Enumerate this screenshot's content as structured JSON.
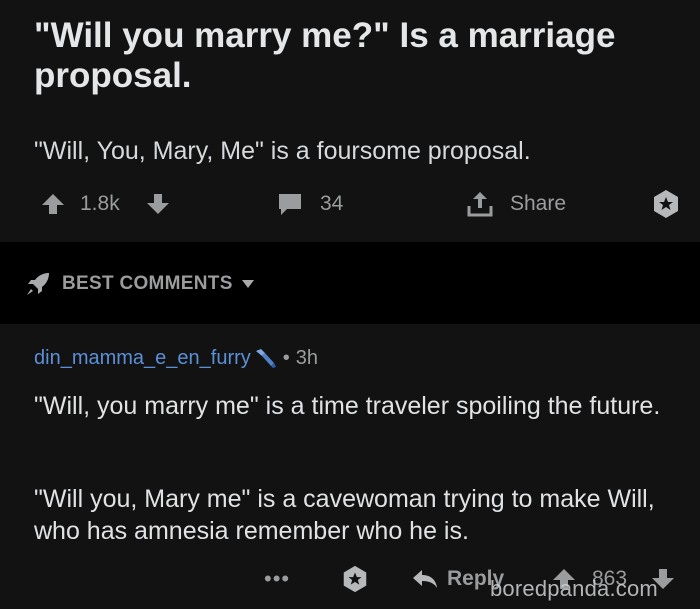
{
  "post": {
    "title": "\"Will you marry me?\" Is a marriage proposal.",
    "body": "\"Will, You, Mary, Me\" is a foursome proposal.",
    "score": "1.8k",
    "comments_count": "34",
    "share_label": "Share"
  },
  "sort": {
    "label": "BEST COMMENTS"
  },
  "comment": {
    "username": "din_mamma_e_en_furry",
    "separator": "•",
    "age": "3h",
    "paragraphs": [
      "\"Will, you marry me\" is a time traveler spoiling the future.",
      "\"Will you, Mary me\" is a cavewoman trying to make Will, who has amnesia remember who he is."
    ],
    "more_label": "•••",
    "reply_label": "Reply",
    "score": "863"
  },
  "watermark": "boredpanda.com",
  "colors": {
    "background": "#121213",
    "band": "#000000",
    "text": "#d7dadc",
    "muted": "#9a9c9e",
    "username": "#5b8fd6"
  },
  "icons": {
    "upvote": "arrow-up-icon",
    "downvote": "arrow-down-icon",
    "comments": "comment-bubble-icon",
    "share": "share-icon",
    "save": "star-badge-icon",
    "sort": "rocket-icon",
    "flair": "tool-icon",
    "reply": "reply-arrow-icon"
  }
}
